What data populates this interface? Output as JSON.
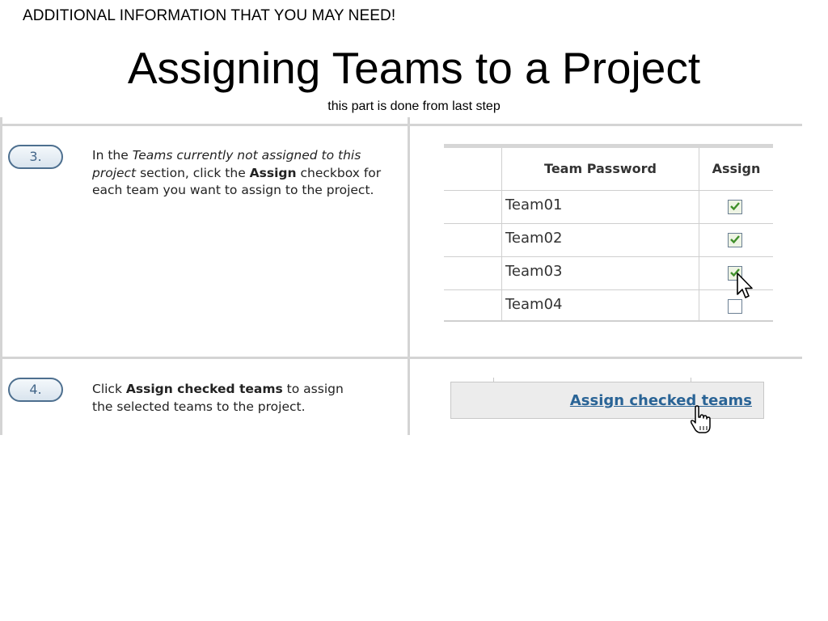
{
  "slide": {
    "note": "ADDITIONAL INFORMATION THAT YOU MAY NEED!",
    "title": "Assigning Teams to a Project",
    "subtitle": "this part is done from last step"
  },
  "steps": [
    {
      "number": "3.",
      "text_parts": {
        "a": "In the ",
        "b": "Teams currently not assigned to this project",
        "c": " section, click the ",
        "d": "Assign",
        "e": " checkbox for each team you want to assign to the project."
      }
    },
    {
      "number": "4.",
      "text_parts": {
        "a": "Click ",
        "b": "Assign checked teams",
        "c": " to assign the selected teams to the project."
      }
    }
  ],
  "team_table": {
    "headers": {
      "password": "Team Password",
      "assign": "Assign"
    },
    "rows": [
      {
        "name": "Team01",
        "checked": true
      },
      {
        "name": "Team02",
        "checked": true
      },
      {
        "name": "Team03",
        "checked": true
      },
      {
        "name": "Team04",
        "checked": false
      }
    ]
  },
  "button_bar": {
    "link_label": "Assign checked teams"
  },
  "colors": {
    "link": "#2a6496",
    "pill_border": "#4d6f8f",
    "check": "#3f8f2a",
    "grid": "#d4d4d4"
  },
  "icons": [
    "arrow-cursor-icon",
    "hand-cursor-icon",
    "check-icon"
  ]
}
